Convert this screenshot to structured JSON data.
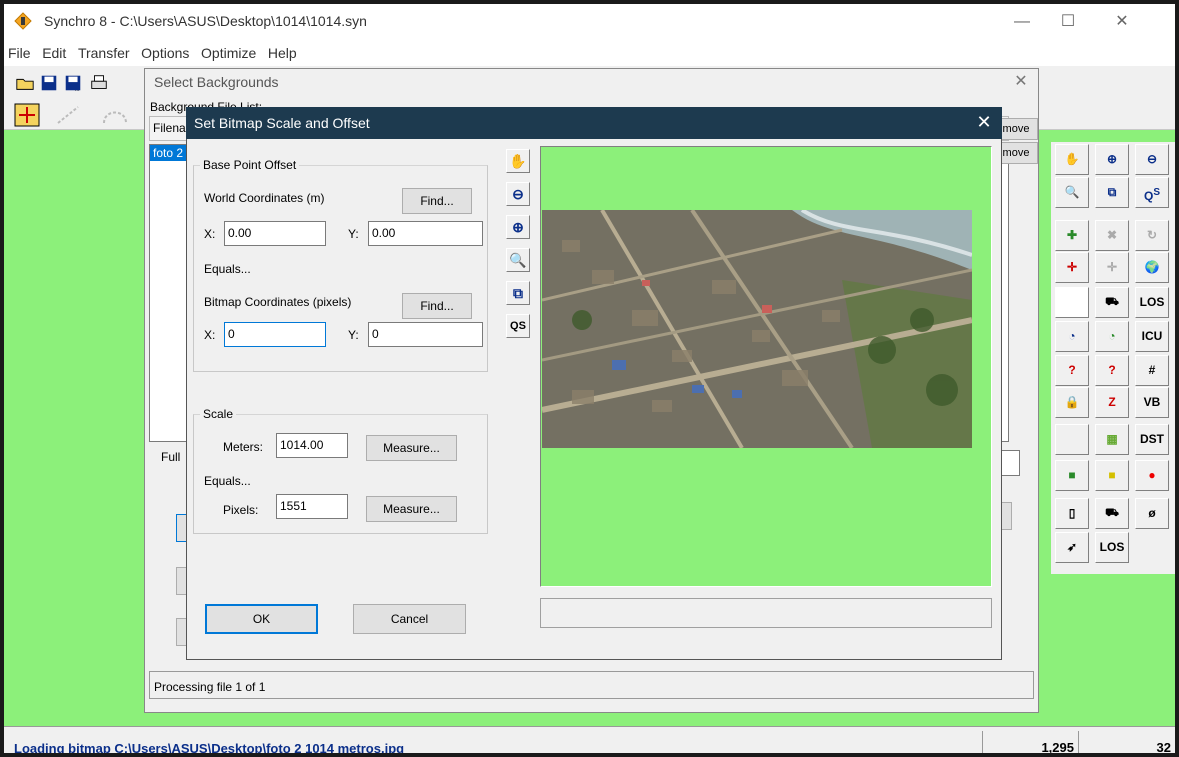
{
  "window": {
    "title": "Synchro 8 - C:\\Users\\ASUS\\Desktop\\1014\\1014.syn",
    "minimize": "—",
    "maximize": "☐",
    "close": "✕"
  },
  "menu": [
    "File",
    "Edit",
    "Transfer",
    "Options",
    "Optimize",
    "Help"
  ],
  "select_backgrounds": {
    "title": "Select Backgrounds",
    "list_label": "Background File List:",
    "column_header": "Filena",
    "selected_file": "foto 2",
    "remove_top": "move",
    "remove_side": "move",
    "full_label": "Full",
    "processing": "Processing file 1 of 1"
  },
  "dialog": {
    "title": "Set Bitmap Scale and Offset",
    "close": "✕",
    "base_point_offset": "Base Point Offset",
    "world_coords_label": "World Coordinates (m)",
    "find_label": "Find...",
    "x_label": "X:",
    "y_label": "Y:",
    "world_x": "0.00",
    "world_y": "0.00",
    "equals": "Equals...",
    "bitmap_coords_label": "Bitmap Coordinates (pixels)",
    "bitmap_x": "0",
    "bitmap_y": "0",
    "scale_label": "Scale",
    "meters_label": "Meters:",
    "meters_value": "1014.00",
    "measure_label": "Measure...",
    "pixels_label": "Pixels:",
    "pixels_value": "1551",
    "ok": "OK",
    "cancel": "Cancel"
  },
  "palette": {
    "los": "LOS",
    "icu": "ICU",
    "vb": "VB",
    "dst": "DST",
    "phi": "ø",
    "los2": "LOS"
  },
  "status": {
    "message": "Loading bitmap C:\\Users\\ASUS\\Desktop\\foto 2 1014 metros.jpg",
    "coord": "1,295",
    "value": "32"
  }
}
